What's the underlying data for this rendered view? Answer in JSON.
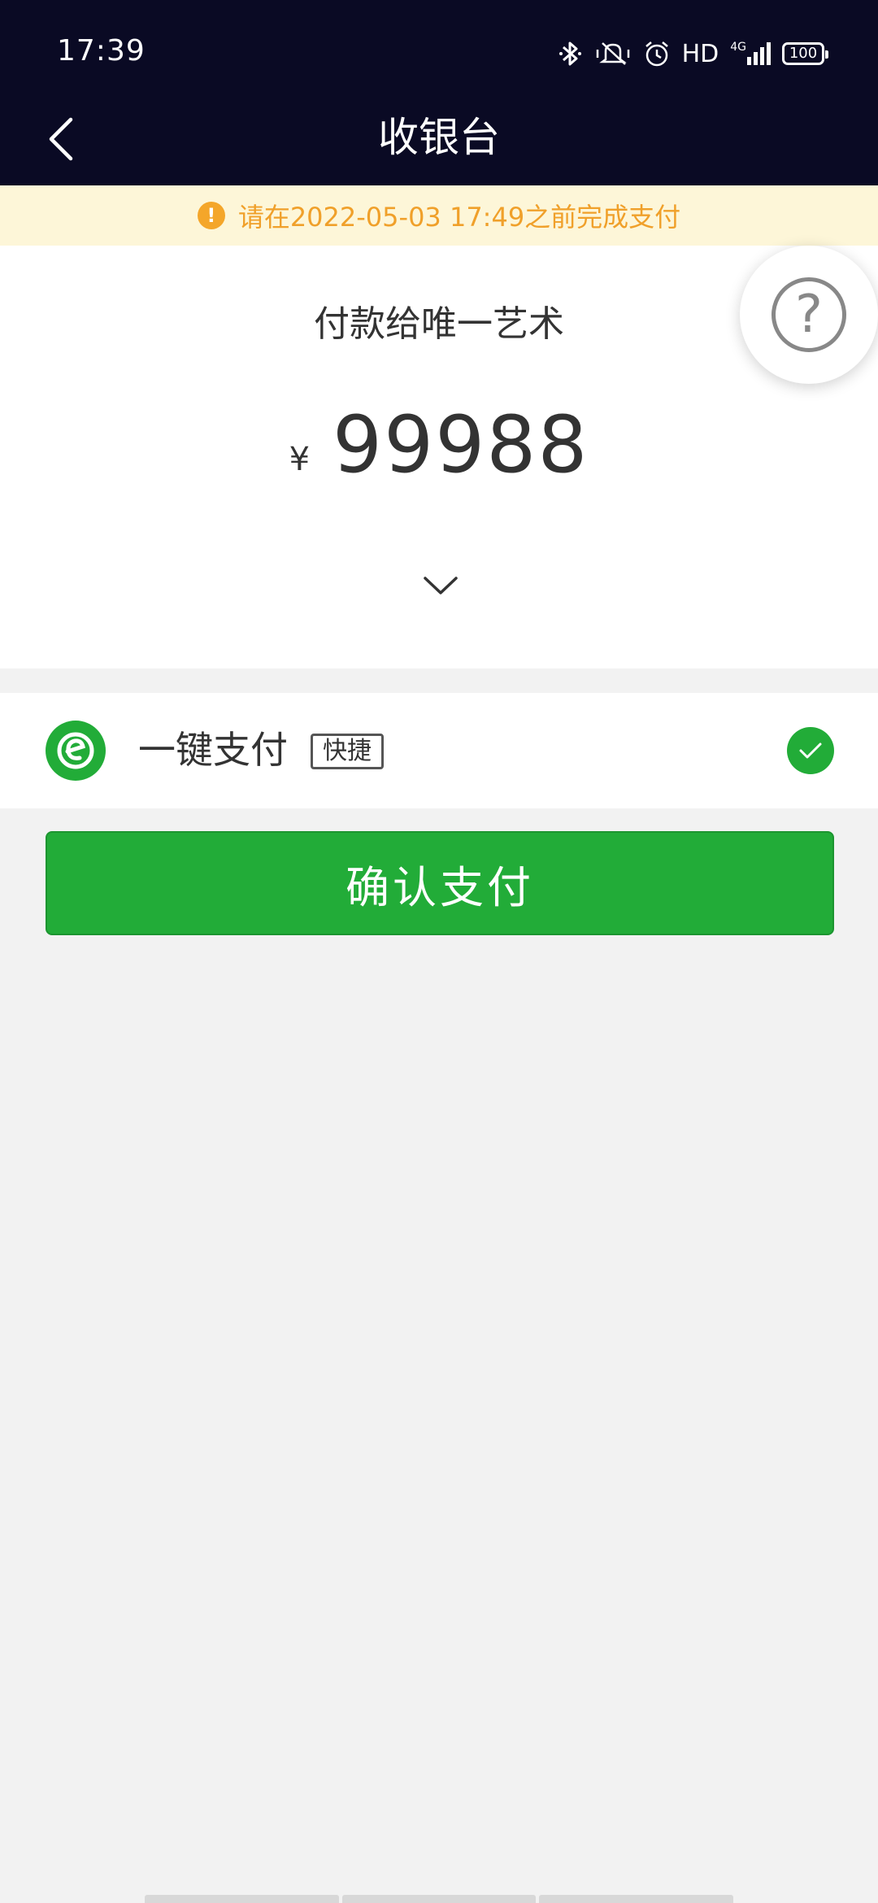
{
  "status_bar": {
    "time": "17:39",
    "hd_label": "HD",
    "network_label": "4G",
    "battery_level": "100",
    "icons": [
      "bluetooth-icon",
      "vibrate-icon",
      "alarm-icon",
      "signal-icon",
      "battery-icon"
    ]
  },
  "nav": {
    "title": "收银台",
    "back_icon": "chevron-left-icon"
  },
  "banner": {
    "icon": "warning-icon",
    "text": "请在2022-05-03 17:49之前完成支付"
  },
  "payment": {
    "payee": "付款给唯一艺术",
    "currency_symbol": "¥",
    "amount": "99988",
    "expand_icon": "chevron-down-icon"
  },
  "help": {
    "icon": "question-icon",
    "label": "?"
  },
  "method": {
    "name": "一键支付",
    "badge": "快捷",
    "logo_icon": "e-pay-logo-icon",
    "selected": true,
    "check_icon": "check-icon"
  },
  "confirm_button": {
    "label": "确认支付"
  },
  "colors": {
    "header_bg": "#0a0a24",
    "banner_bg": "#fdf6d8",
    "banner_text": "#f0a02a",
    "accent_green": "#22ac38",
    "page_bg": "#f2f2f2"
  }
}
